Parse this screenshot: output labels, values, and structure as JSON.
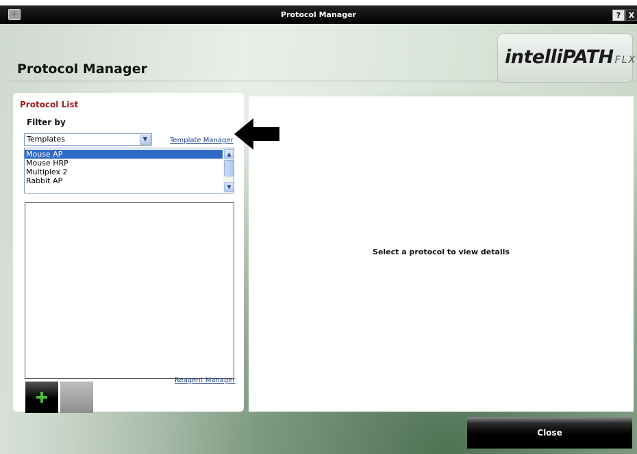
{
  "window": {
    "title": "Protocol Manager",
    "app_icon_glyph": "⊹",
    "help_label": "?",
    "close_label": "X"
  },
  "header": {
    "page_title": "Protocol Manager",
    "logo_main": "intelliPATH",
    "logo_sub": "FLX"
  },
  "left_panel": {
    "title": "Protocol List",
    "filter_label": "Filter by",
    "filter_select": {
      "value": "Templates"
    },
    "template_manager_link": "Template Manager",
    "template_list": {
      "items": [
        "Mouse AP",
        "Mouse HRP",
        "Multiplex 2",
        "Rabbit AP"
      ],
      "selected_index": 0
    },
    "reagent_manager_link": "Reagent Manager",
    "add_button_icon": "plus-icon",
    "delete_button_glyph": "✕"
  },
  "right_panel": {
    "message": "Select a protocol to view details"
  },
  "footer": {
    "close_label": "Close"
  },
  "colors": {
    "panel_title": "#9b1b1b",
    "selection": "#316ac5",
    "add_icon": "#4cbb3c",
    "link": "#1f3f8f"
  }
}
